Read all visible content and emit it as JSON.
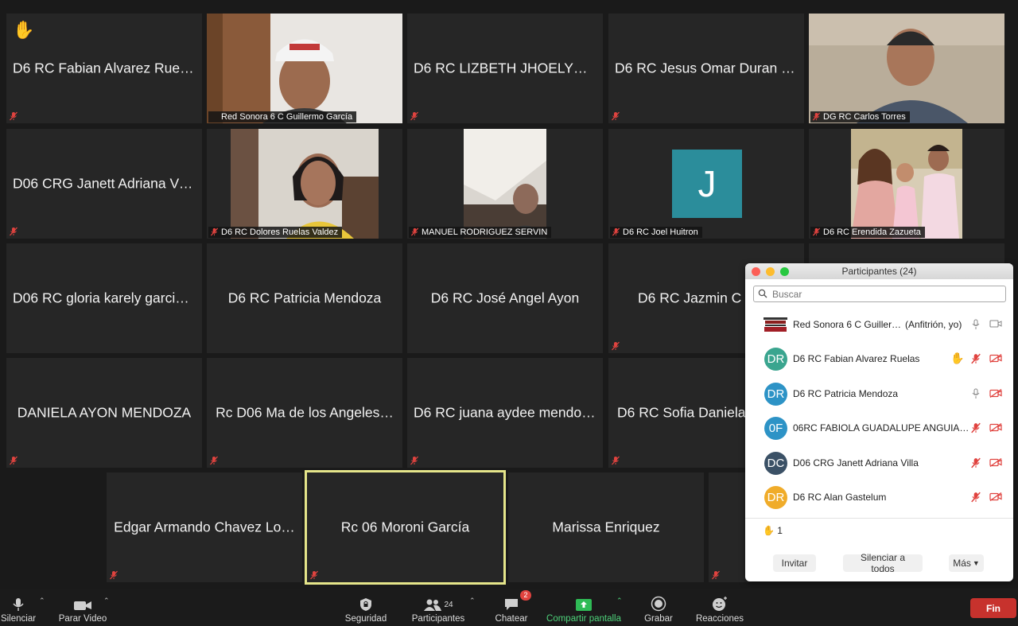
{
  "tiles": [
    {
      "name": "D6 RC Fabian Alvarez Ruelas",
      "hand": "✋"
    },
    {
      "name": "Red Sonora 6 C Guillermo García"
    },
    {
      "name": "D6 RC LIZBETH JHOELYN…"
    },
    {
      "name": "D6 RC Jesus Omar Duran S…"
    },
    {
      "name": "DG RC Carlos Torres"
    },
    {
      "name": "D06 CRG Janett Adriana Vi…"
    },
    {
      "name": "D6 RC Dolores Ruelas Valdez"
    },
    {
      "name": "MANUEL RODRIGUEZ SERVIN"
    },
    {
      "name": "D6 RC Joel Huitron",
      "initial": "J"
    },
    {
      "name": "D6 RC Erendida Zazueta"
    },
    {
      "name": "D06 RC gloria karely garcia…"
    },
    {
      "name": "D6 RC Patricia Mendoza"
    },
    {
      "name": "D6 RC José Angel Ayon"
    },
    {
      "name": "D6 RC Jazmin C"
    },
    {
      "name": "DANIELA AYON MENDOZA"
    },
    {
      "name": "Rc D06 Ma de los Angeles…"
    },
    {
      "name": "D6 RC juana aydee mendoz…"
    },
    {
      "name": "D6 RC Sofia Daniela"
    },
    {
      "name": "Edgar Armando Chavez Lo…"
    },
    {
      "name": "Rc 06 Moroni García"
    },
    {
      "name": "Marissa Enriquez"
    }
  ],
  "panel": {
    "title": "Participantes (24)",
    "search_placeholder": "Buscar",
    "host": {
      "name": "Red Sonora 6 C Guiller…",
      "role": "(Anfitrión, yo)",
      "logo_text": "morena"
    },
    "participants": [
      {
        "initials": "DR",
        "name": "D6 RC Fabian Alvarez Ruelas",
        "color": "#3aa58f",
        "hand": "✋"
      },
      {
        "initials": "DR",
        "name": "D6 RC Patricia Mendoza",
        "color": "#2d93c6"
      },
      {
        "initials": "0F",
        "name": "06RC FABIOLA GUADALUPE ANGUIA…",
        "color": "#2d93c6"
      },
      {
        "initials": "DC",
        "name": "D06 CRG Janett Adriana Villa",
        "color": "#3b5166"
      },
      {
        "initials": "DR",
        "name": "D6 RC Alan Gastelum",
        "color": "#f0ac2a"
      }
    ],
    "raised_count": "1",
    "raised_icon": "✋",
    "buttons": {
      "invite": "Invitar",
      "mute_all": "Silenciar a todos",
      "more": "Más"
    }
  },
  "toolbar": {
    "mute": "Silenciar",
    "stop_video": "Parar Video",
    "security": "Seguridad",
    "participants": "Participantes",
    "participants_count": "24",
    "chat": "Chatear",
    "chat_badge": "2",
    "share": "Compartir pantalla",
    "record": "Grabar",
    "reactions": "Reacciones",
    "end": "Fin"
  },
  "colors": {
    "accent_green": "#4ed27a",
    "end_red": "#c7322d",
    "active_speaker": "#e5e58a",
    "muted_red": "#e0433f"
  }
}
